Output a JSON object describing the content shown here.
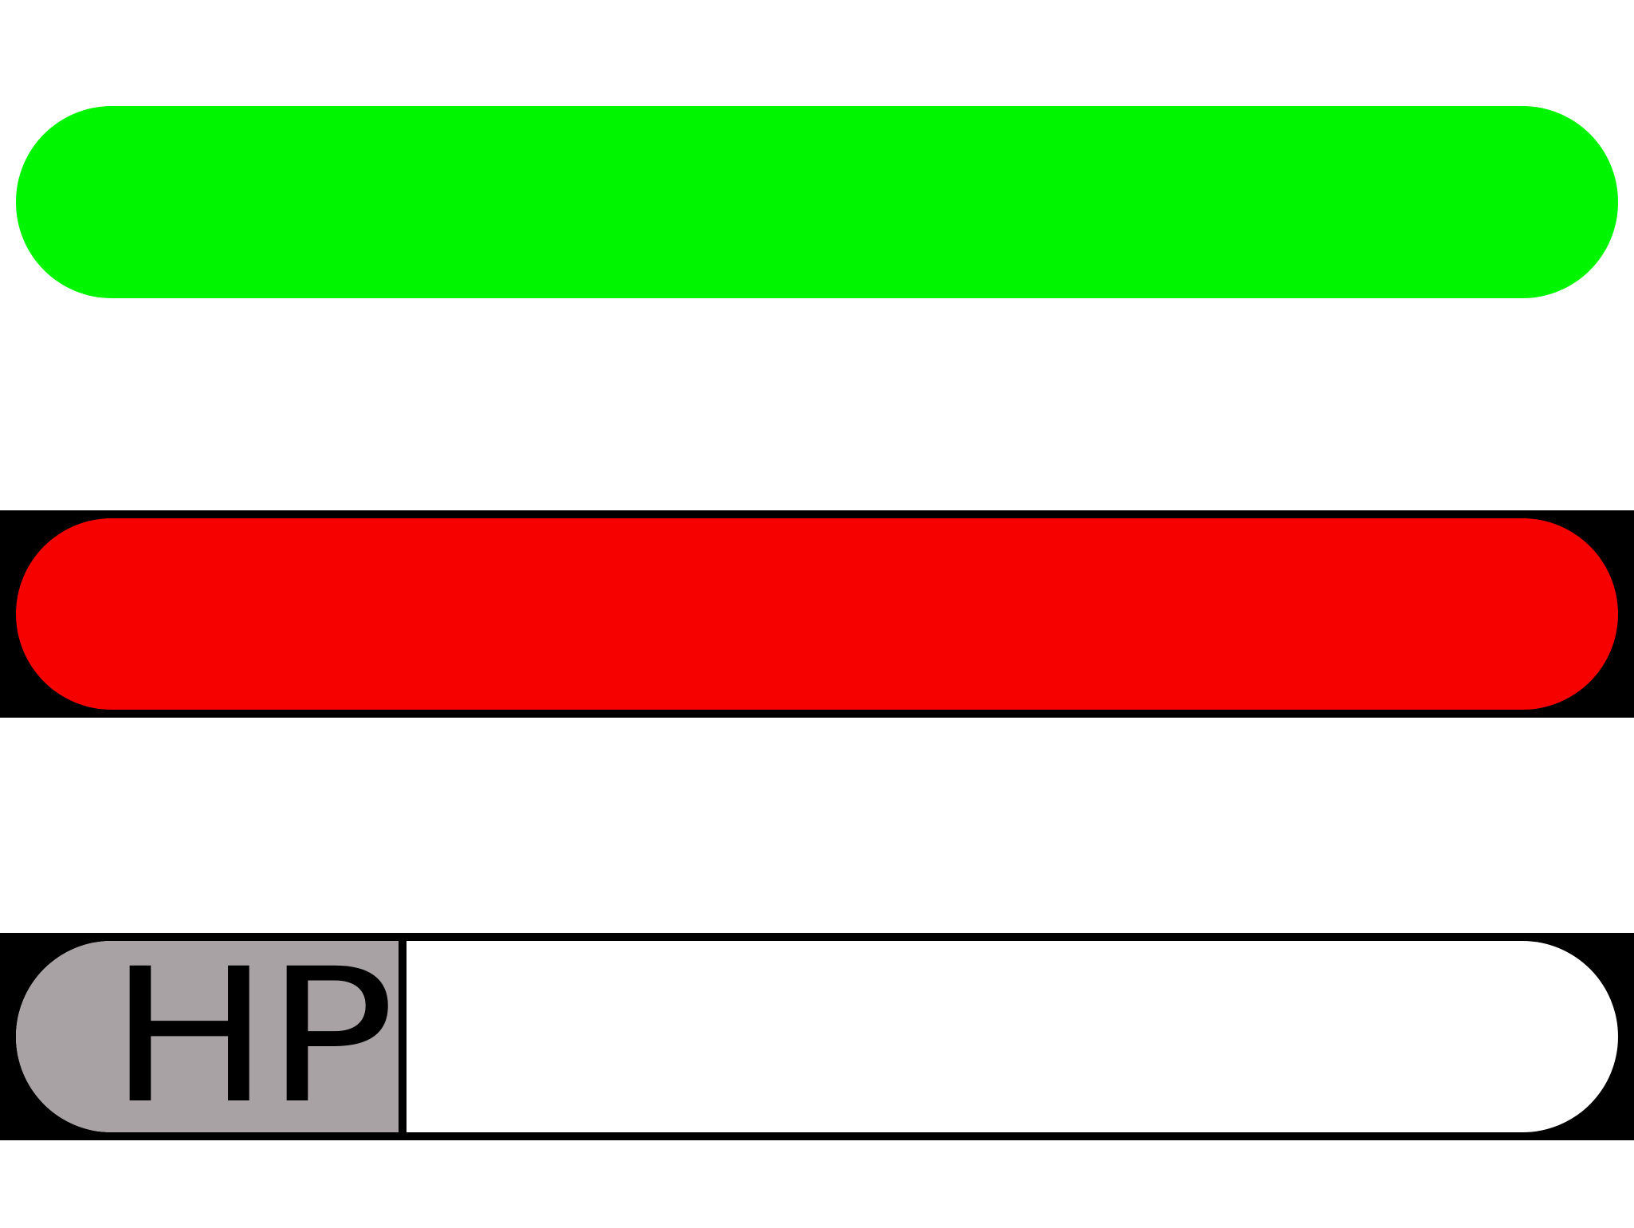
{
  "bars": {
    "green": {
      "color": "#00f500",
      "level_percent": 100
    },
    "red": {
      "color": "#f70000",
      "level_percent": 100,
      "frame_color": "#000000"
    },
    "hp": {
      "label": "HP",
      "label_bg": "#a8a2a4",
      "frame_color": "#000000",
      "track_color": "#ffffff",
      "fill_color": "#ffffff",
      "level_percent": 0
    }
  }
}
